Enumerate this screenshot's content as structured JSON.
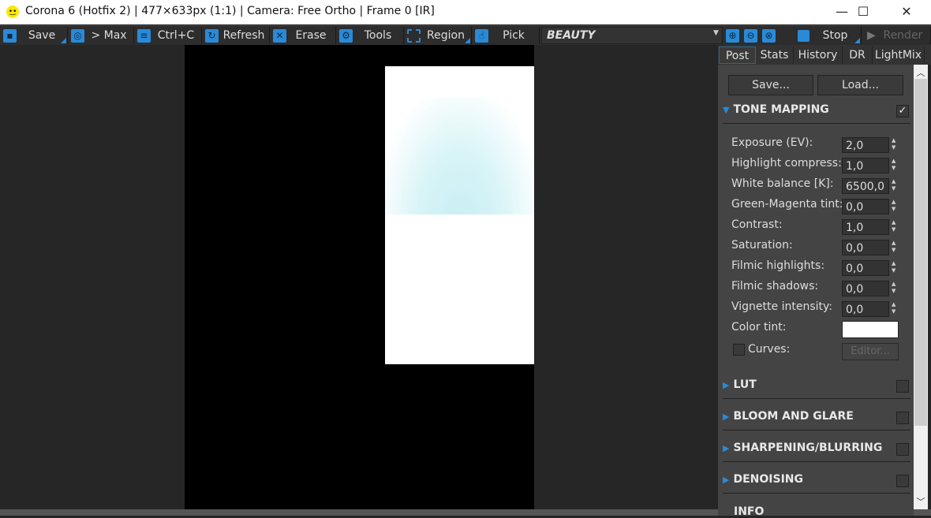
{
  "window": {
    "title": "Corona 6 (Hotfix 2) | 477×633px (1:1) | Camera: Free Ortho | Frame 0 [IR]",
    "minimize": "—",
    "maximize": "☐",
    "close": "✕"
  },
  "toolbar": {
    "save": "Save",
    "max": "> Max",
    "copy": "Ctrl+C",
    "refresh": "Refresh",
    "erase": "Erase",
    "tools": "Tools",
    "region": "Region",
    "pick": "Pick",
    "channel": "BEAUTY",
    "stop": "Stop",
    "render": "Render"
  },
  "tabs": [
    "Post",
    "Stats",
    "History",
    "DR",
    "LightMix"
  ],
  "post": {
    "save": "Save...",
    "load": "Load...",
    "tone_mapping": {
      "title": "TONE MAPPING",
      "enabled": true,
      "params": [
        {
          "label": "Exposure (EV):",
          "value": "2,0"
        },
        {
          "label": "Highlight compress:",
          "value": "1,0"
        },
        {
          "label": "White balance [K]:",
          "value": "6500,0"
        },
        {
          "label": "Green-Magenta tint:",
          "value": "0,0"
        },
        {
          "label": "Contrast:",
          "value": "1,0"
        },
        {
          "label": "Saturation:",
          "value": "0,0"
        },
        {
          "label": "Filmic highlights:",
          "value": "0,0"
        },
        {
          "label": "Filmic shadows:",
          "value": "0,0"
        },
        {
          "label": "Vignette intensity:",
          "value": "0,0"
        }
      ],
      "color_tint": "Color tint:",
      "color_tint_value": "#ffffff",
      "curves": "Curves:",
      "editor": "Editor..."
    },
    "sections": [
      "LUT",
      "BLOOM AND GLARE",
      "SHARPENING/BLURRING",
      "DENOISING",
      "INFO"
    ]
  }
}
